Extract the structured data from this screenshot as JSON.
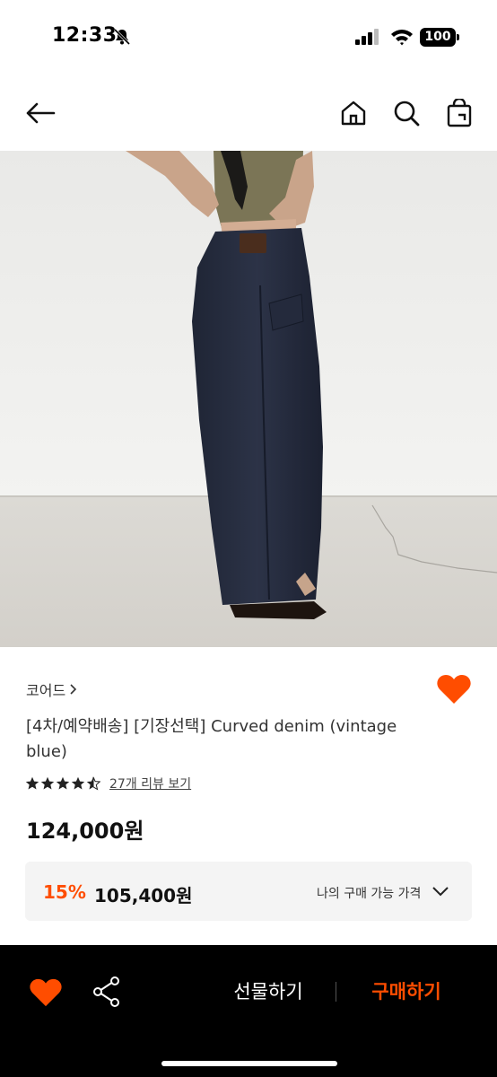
{
  "status_bar": {
    "time": "12:33",
    "battery": "100"
  },
  "product": {
    "brand": "코어드",
    "title": "[4차/예약배송] [기장선택] Curved denim (vintage blue)",
    "rating": 4.5,
    "review_link": "27개 리뷰 보기",
    "price": "124,000원",
    "discount_rate": "15%",
    "discount_price": "105,400원",
    "my_price_label": "나의 구매 가능 가격"
  },
  "bottom_bar": {
    "gift_label": "선물하기",
    "buy_label": "구매하기"
  },
  "colors": {
    "accent": "#ff4d00",
    "wish": "#ff4d00",
    "bottom_bar": "#000000",
    "discount_bg": "#f4f4f4"
  },
  "icons": [
    "back-arrow-icon",
    "home-icon",
    "search-icon",
    "shopping-bag-icon",
    "heart-icon",
    "share-icon",
    "chevron-down-icon",
    "chevron-right-icon",
    "star-icon"
  ]
}
